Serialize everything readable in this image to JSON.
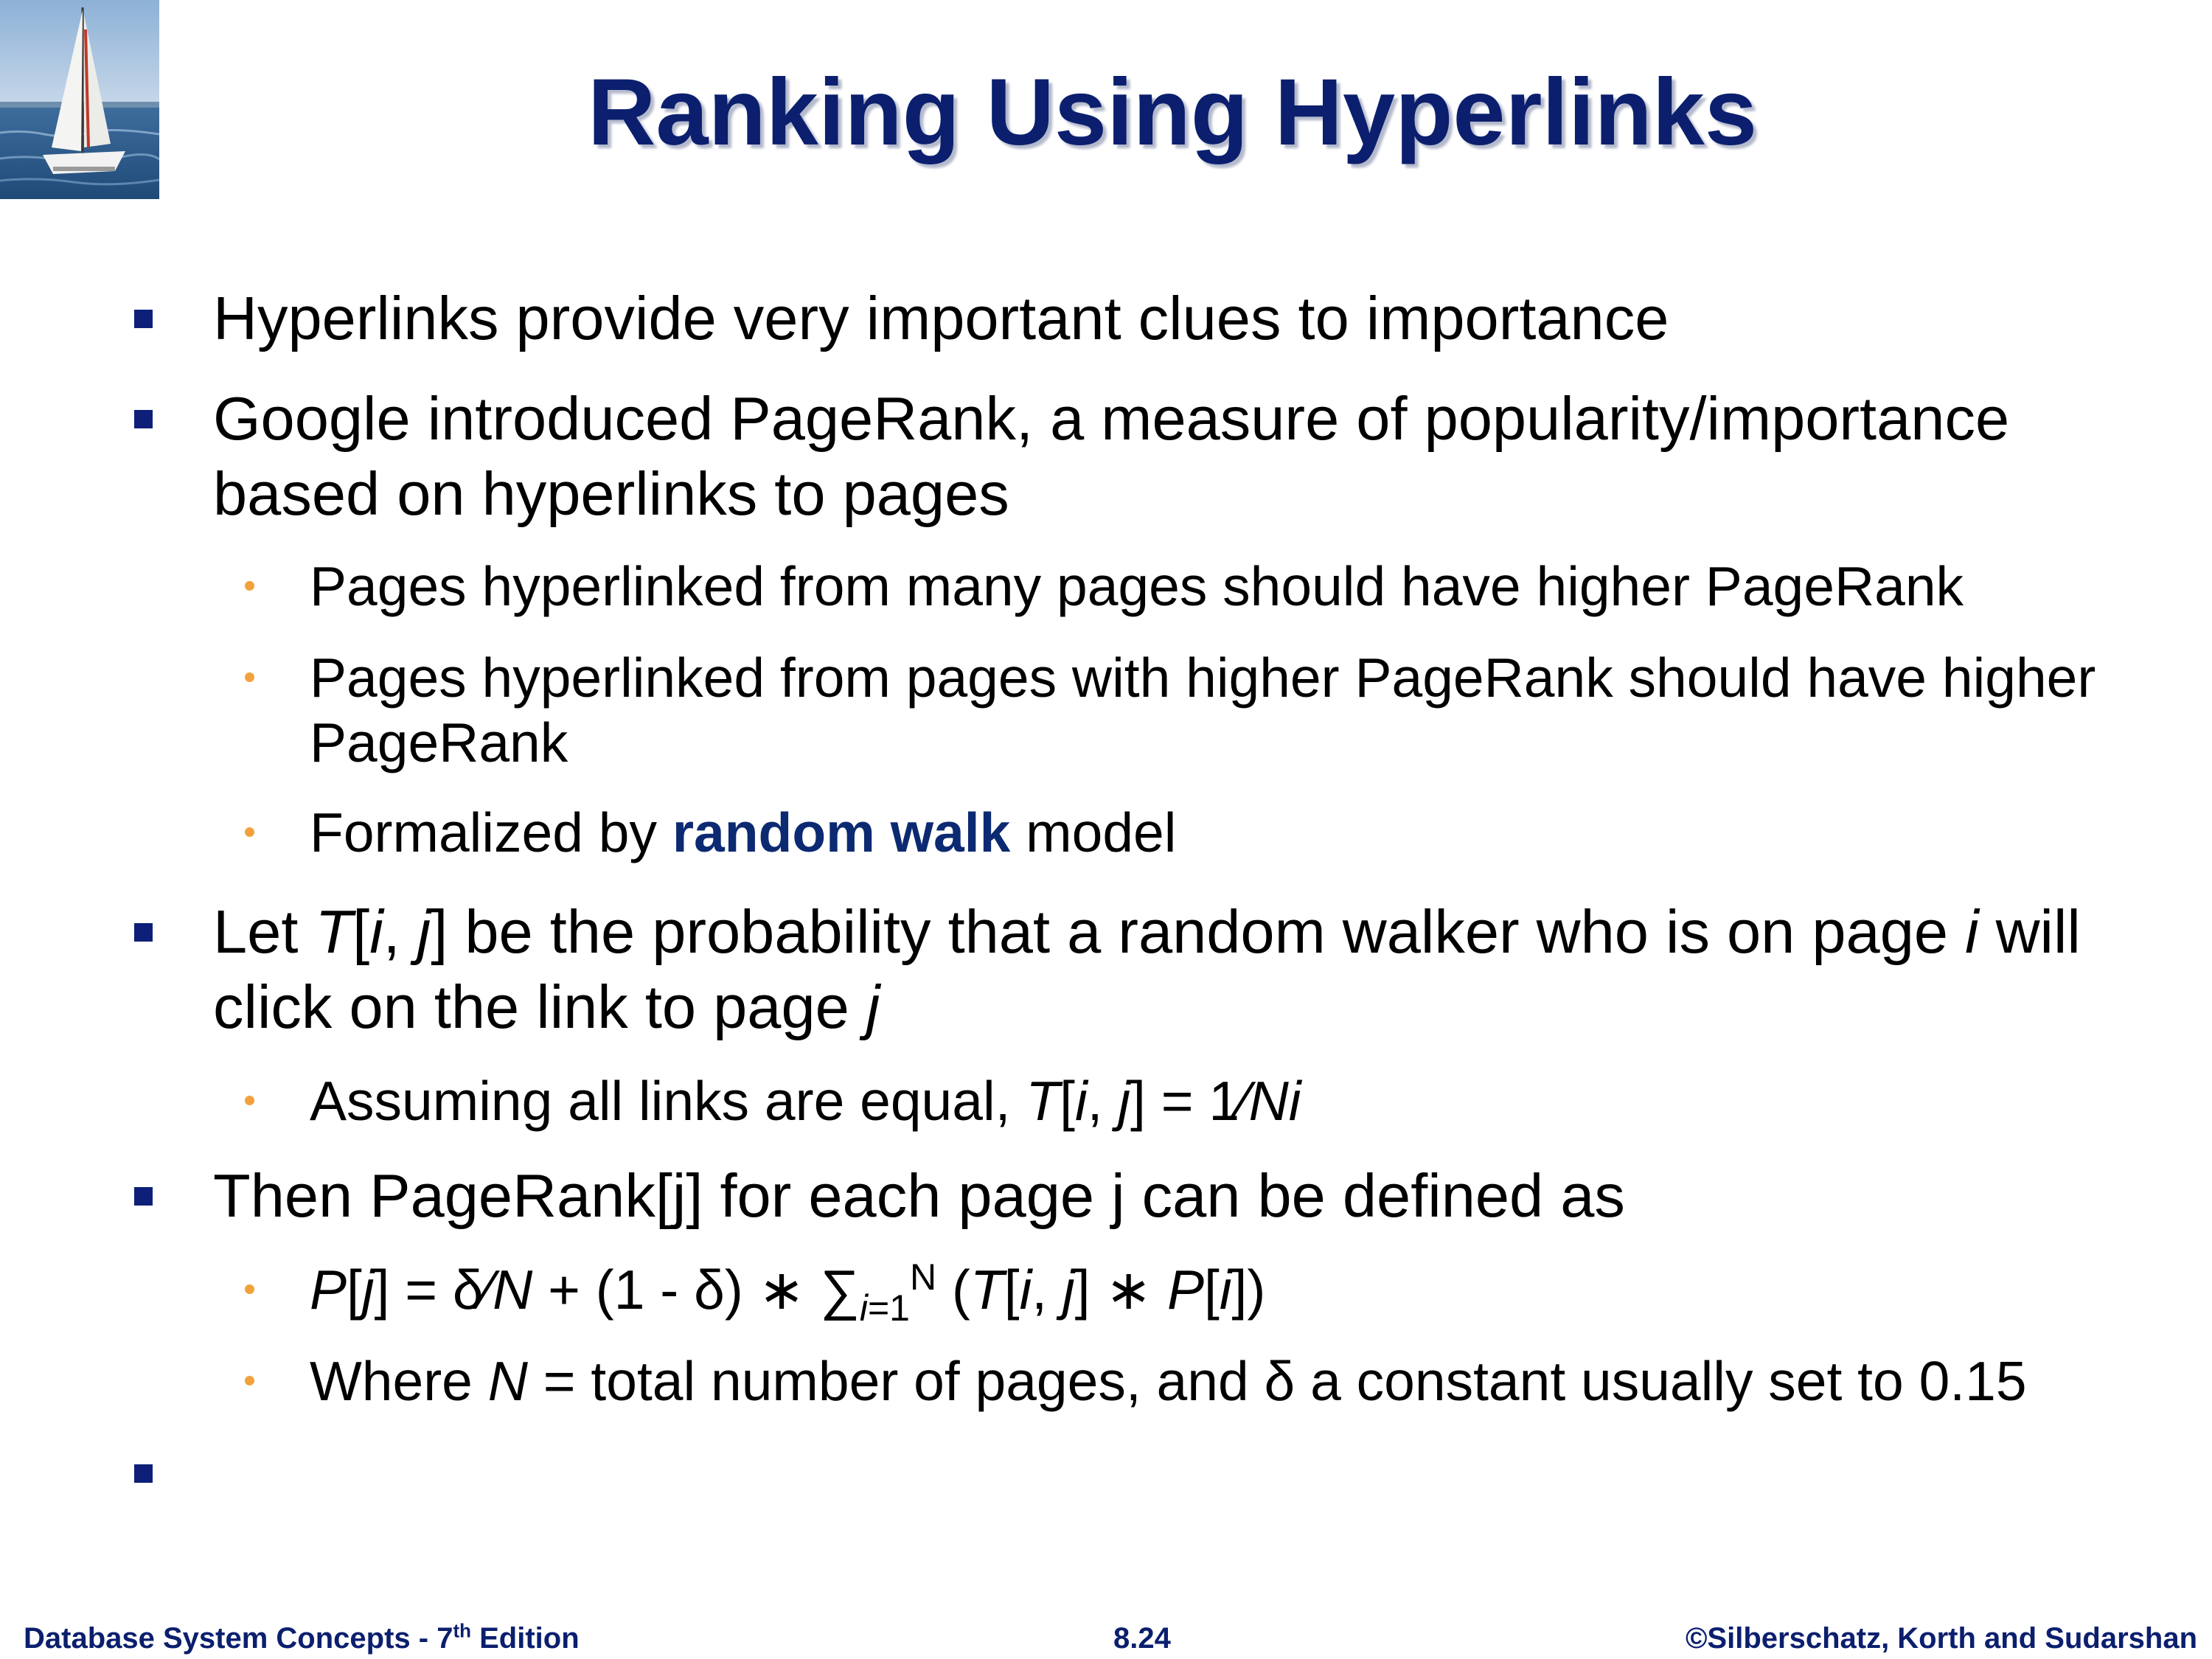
{
  "title": "Ranking Using Hyperlinks",
  "bullets": {
    "b1": "Hyperlinks provide very important clues to importance",
    "b2_line1": "Google introduced PageRank, a measure of popularity/importance",
    "b2_line2": "based on hyperlinks to pages",
    "b2_s1": "Pages hyperlinked from many pages should have higher PageRank",
    "b2_s2_line1": "Pages hyperlinked from pages with higher PageRank should have higher",
    "b2_s2_line2": "PageRank",
    "b2_s3_pre": "Formalized by ",
    "b2_s3_bold": "random walk",
    "b2_s3_post": " model",
    "b3_line1": {
      "p1": "Let ",
      "T": "T",
      "p2": "[",
      "i": "i",
      "p3": ", ",
      "j": "j",
      "p4": "] be the probability that a random walker who is on page ",
      "i2": "i",
      "p5": " will"
    },
    "b3_line2": {
      "p1": "click on the link to page ",
      "j": "j"
    },
    "b3_s1": {
      "p1": "Assuming all links are equal, ",
      "T": "T",
      "p2": "[",
      "i": "i",
      "p3": ", ",
      "j": "j",
      "p4": "] = 1⁄",
      "Ni": "Ni"
    },
    "b4": "Then PageRank[j] for each page j can be defined as",
    "b4_s1": {
      "P": "P",
      "p1": "[",
      "j": "j",
      "p2": "] = δ⁄",
      "N": "N",
      "p3": " + (1 - δ) ∗ ∑",
      "sub_i": "i",
      "sub_rest": "=1",
      "sup": "N",
      "p4": " (",
      "T": "T",
      "p5": "[",
      "i": "i",
      "p6": ", ",
      "j2": "j",
      "p7": "] ∗ ",
      "P2": "P",
      "p8": "[",
      "i2": "i",
      "p9": "])"
    },
    "b4_s2": {
      "p1": "Where ",
      "N": "N",
      "p2": " = total number of pages, and δ a constant usually set to 0.15"
    }
  },
  "footer": {
    "left": "Database System Concepts - 7",
    "left_sup": "th",
    "left_post": " Edition",
    "center": "8.24",
    "right": "©Silberschatz, Korth and Sudarshan"
  },
  "colors": {
    "title": "#0b1f6e",
    "level1_bullet": "#0d1f78",
    "level2_bullet": "#f2a23a",
    "highlight": "#0b2a72"
  },
  "icons": {
    "logo": "sailboat-logo"
  }
}
